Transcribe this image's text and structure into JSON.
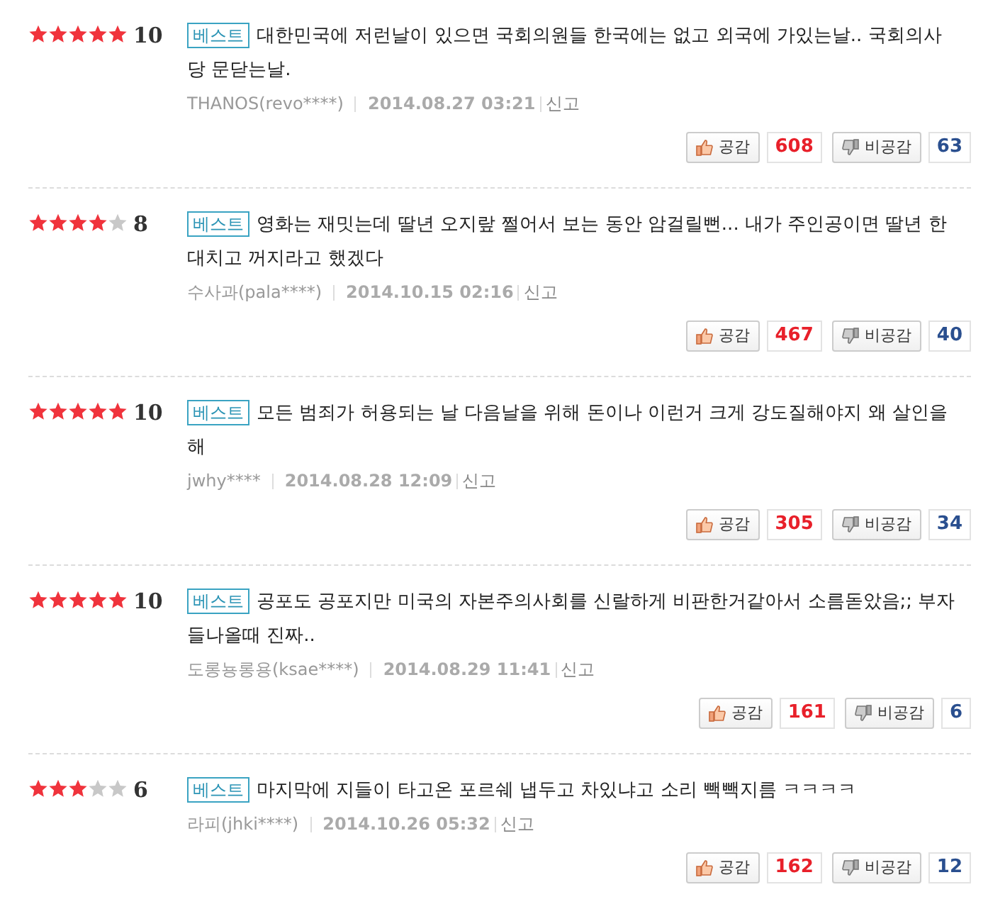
{
  "reviews": [
    {
      "stars": 5,
      "score": "10",
      "badge": "베스트",
      "text": "대한민국에 저런날이 있으면 국회의원들 한국에는 없고 외국에 가있는날.. 국회의사당 문닫는날.",
      "author": "THANOS(revo****)",
      "date": "2014.08.27 03:21",
      "report": "신고",
      "like_label": "공감",
      "likes": "608",
      "dislike_label": "비공감",
      "dislikes": "63"
    },
    {
      "stars": 4,
      "score": "8",
      "badge": "베스트",
      "text": "영화는 재밋는데 딸년 오지랖 쩔어서 보는 동안 암걸릴뻔... 내가 주인공이면 딸년 한대치고 꺼지라고 했겠다",
      "author": "수사과(pala****)",
      "date": "2014.10.15 02:16",
      "report": "신고",
      "like_label": "공감",
      "likes": "467",
      "dislike_label": "비공감",
      "dislikes": "40"
    },
    {
      "stars": 5,
      "score": "10",
      "badge": "베스트",
      "text": "모든 범죄가 허용되는 날 다음날을 위해 돈이나 이런거 크게 강도질해야지 왜 살인을 해",
      "author": "jwhy****",
      "date": "2014.08.28 12:09",
      "report": "신고",
      "like_label": "공감",
      "likes": "305",
      "dislike_label": "비공감",
      "dislikes": "34"
    },
    {
      "stars": 5,
      "score": "10",
      "badge": "베스트",
      "text": "공포도 공포지만 미국의 자본주의사회를 신랄하게 비판한거같아서 소름돋았음;; 부자들나올때 진짜..",
      "author": "도롱뇽롱용(ksae****)",
      "date": "2014.08.29 11:41",
      "report": "신고",
      "like_label": "공감",
      "likes": "161",
      "dislike_label": "비공감",
      "dislikes": "6"
    },
    {
      "stars": 3,
      "score": "6",
      "badge": "베스트",
      "text": "마지막에 지들이 타고온 포르쉐 냅두고 차있냐고 소리 빽빽지름 ㅋㅋㅋㅋ",
      "author": "라피(jhki****)",
      "date": "2014.10.26 05:32",
      "report": "신고",
      "like_label": "공감",
      "likes": "162",
      "dislike_label": "비공감",
      "dislikes": "12"
    }
  ]
}
